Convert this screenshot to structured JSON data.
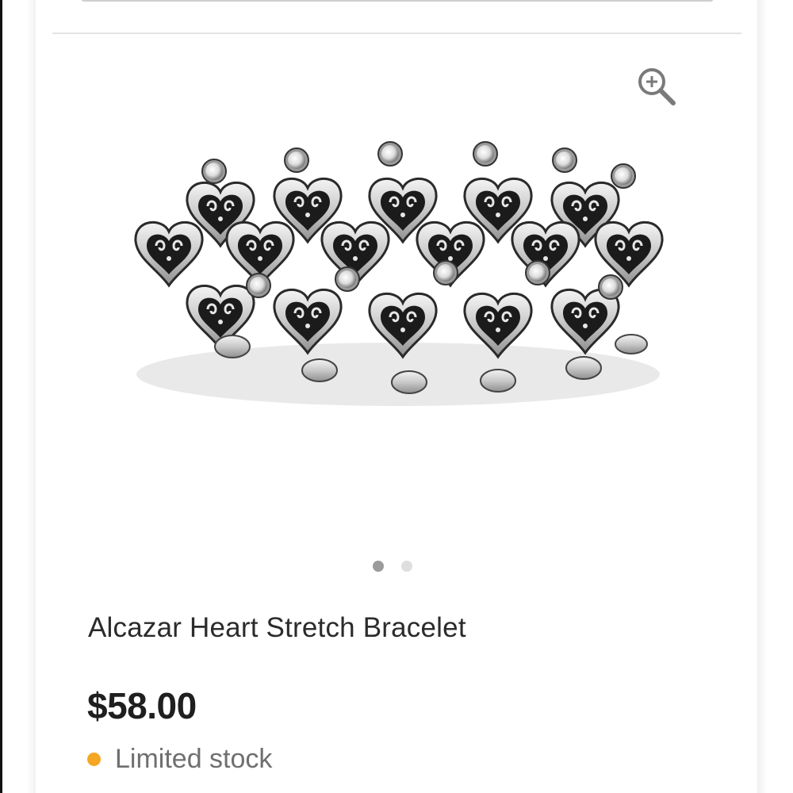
{
  "product": {
    "title": "Alcazar Heart Stretch Bracelet",
    "price": "$58.00",
    "stock_status": "Limited stock",
    "stock_color": "#f5a623",
    "image_icon": "bracelet-image",
    "zoom_icon": "zoom-in-icon"
  },
  "gallery": {
    "slides": 2,
    "active_slide": 1
  }
}
